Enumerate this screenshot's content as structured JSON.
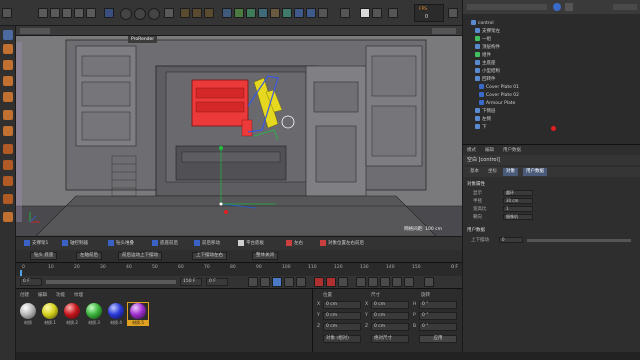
{
  "viewport": {
    "hud_label": "ProRender",
    "scale_label": "网格间距: 100 cm"
  },
  "top_toolbar": {
    "fps_label": "FPS",
    "fps_value": "0"
  },
  "object_manager": {
    "items": [
      "control",
      "支撑架左",
      "一组",
      "顶层构件",
      "组件",
      "主底座",
      "小型结构",
      "回转件",
      "Cover Plate 01",
      "Cover Plate 02",
      "Armour Plate",
      "下侧层",
      "左侧",
      "下"
    ]
  },
  "attributes": {
    "header_tabs": [
      "模式",
      "编辑",
      "用户数据"
    ],
    "object_title": "空白 [control]",
    "tabs": [
      "基本",
      "坐标",
      "对象",
      "用户数据"
    ],
    "section_object": "对象属性",
    "props": [
      {
        "label": "显示",
        "value": "圆环"
      },
      {
        "label": "半径",
        "value": "30 cm"
      },
      {
        "label": "宽高比",
        "value": "1"
      },
      {
        "label": "朝向",
        "value": "摄像机"
      }
    ],
    "section_user": "用户数据",
    "user_prop": {
      "label": "上下摆动",
      "value": "0"
    }
  },
  "layer_tabs": [
    {
      "label": "支撑架1",
      "color": "#3a62c4"
    },
    {
      "label": "轴控制器",
      "color": "#3a62c4"
    },
    {
      "label": "钻头堆叠",
      "color": "#3a62c4"
    },
    {
      "label": "底座前后",
      "color": "#3a62c4"
    },
    {
      "label": "前后移动",
      "color": "#3a62c4"
    },
    {
      "label": "平台底板",
      "color": "#d0d0d0"
    },
    {
      "label": "左右",
      "color": "#c94040"
    },
    {
      "label": "对象位置左右前后",
      "color": "#c94040"
    }
  ],
  "row2_pills": [
    "钻头 底座",
    "左轴前后",
    "前后运动上下摆动",
    "上下摆动左右",
    "整体关闭"
  ],
  "timeline": {
    "ticks": [
      "0",
      "10",
      "20",
      "30",
      "40",
      "50",
      "60",
      "70",
      "80",
      "90",
      "100",
      "110",
      "120",
      "130",
      "140",
      "150"
    ],
    "current_frame": "0 F",
    "start": "0 F",
    "end": "150 F",
    "fps_field": "0 F"
  },
  "material_manager": {
    "menu": [
      "创建",
      "编辑",
      "功能",
      "纹理"
    ],
    "materials": [
      {
        "label": "材质",
        "color": "#b8b8b8"
      },
      {
        "label": "材质.1",
        "color": "#d6d21e"
      },
      {
        "label": "材质.2",
        "color": "#c4161c"
      },
      {
        "label": "材质.3",
        "color": "#3cb43c"
      },
      {
        "label": "材质.4",
        "color": "#2a3ad8"
      },
      {
        "label": "材质.5",
        "color": "#a030d0"
      }
    ]
  },
  "coordinates": {
    "headers": [
      "位置",
      "尺寸",
      "旋转"
    ],
    "rows": [
      {
        "axis": "X",
        "pos": "0 cm",
        "size": "0 cm",
        "rot_axis": "H",
        "rot": "0 °"
      },
      {
        "axis": "Y",
        "pos": "0 cm",
        "size": "0 cm",
        "rot_axis": "P",
        "rot": "0 °"
      },
      {
        "axis": "Z",
        "pos": "0 cm",
        "size": "0 cm",
        "rot_axis": "B",
        "rot": "0 °"
      }
    ],
    "mode_select": "对象 (相对)",
    "size_select": "绝对尺寸",
    "apply_button": "应用"
  },
  "colors": {
    "accent": "#4a6fa5",
    "viewport_bg": "#7b7b7e",
    "red_object": "#ec3a3a",
    "yellow_object": "#e6d81e"
  }
}
